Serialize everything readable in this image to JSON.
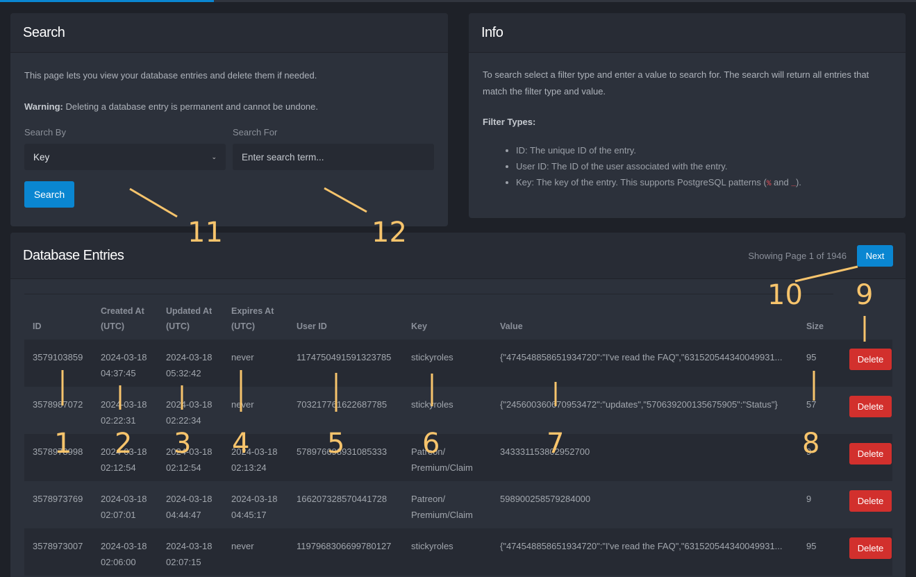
{
  "search": {
    "title": "Search",
    "intro": "This page lets you view your database entries and delete them if needed.",
    "warning_label": "Warning:",
    "warning_text": " Deleting a database entry is permanent and cannot be undone.",
    "search_by_label": "Search By",
    "search_by_value": "Key",
    "search_for_label": "Search For",
    "search_for_placeholder": "Enter search term...",
    "search_button": "Search"
  },
  "info": {
    "title": "Info",
    "text": "To search select a filter type and enter a value to search for. The search will return all entries that match the filter type and value.",
    "filter_title": "Filter Types:",
    "items": [
      "ID: The unique ID of the entry.",
      "User ID: The ID of the user associated with the entry."
    ],
    "key_item_pre": "Key: The key of the entry. This supports PostgreSQL patterns (",
    "key_item_code1": "%",
    "key_item_mid": " and ",
    "key_item_code2": "_",
    "key_item_post": ")."
  },
  "entries": {
    "title": "Database Entries",
    "page_info": "Showing Page 1 of 1946",
    "next_button": "Next",
    "columns": [
      "ID",
      "Created At (UTC)",
      "Updated At (UTC)",
      "Expires At (UTC)",
      "User ID",
      "Key",
      "Value",
      "Size",
      ""
    ],
    "delete_label": "Delete",
    "rows": [
      [
        "3579103859",
        "2024-03-18 04:37:45",
        "2024-03-18 05:32:42",
        "never",
        "1174750491591323785",
        "stickyroles",
        "{\"474548858651934720\":\"I've read the FAQ\",\"631520544340049931...",
        "95"
      ],
      [
        "3578987072",
        "2024-03-18 02:22:31",
        "2024-03-18 02:22:34",
        "never",
        "703217761622687785",
        "stickyroles",
        "{\"245600360670953472\":\"updates\",\"570639200135675905\":\"Status\"}",
        "57"
      ],
      [
        "3578978998",
        "2024-03-18 02:12:54",
        "2024-03-18 02:12:54",
        "2024-03-18 02:13:24",
        "578976698931085333",
        "Patreon/ Premium/Claim",
        "343331153802952700",
        "9"
      ],
      [
        "3578973769",
        "2024-03-18 02:07:01",
        "2024-03-18 04:44:47",
        "2024-03-18 04:45:17",
        "166207328570441728",
        "Patreon/ Premium/Claim",
        "598900258579284000",
        "9"
      ],
      [
        "3578973007",
        "2024-03-18 02:06:00",
        "2024-03-18 02:07:15",
        "never",
        "1197968306699780127",
        "stickyroles",
        "{\"474548858651934720\":\"I've read the FAQ\",\"631520544340049931...",
        "95"
      ]
    ]
  },
  "annotations": [
    "1",
    "2",
    "3",
    "4",
    "5",
    "6",
    "7",
    "8",
    "9",
    "10",
    "11",
    "12"
  ],
  "colors": {
    "accent": "#0a86d1",
    "danger": "#d2302d",
    "annotation": "#f7c46c"
  }
}
